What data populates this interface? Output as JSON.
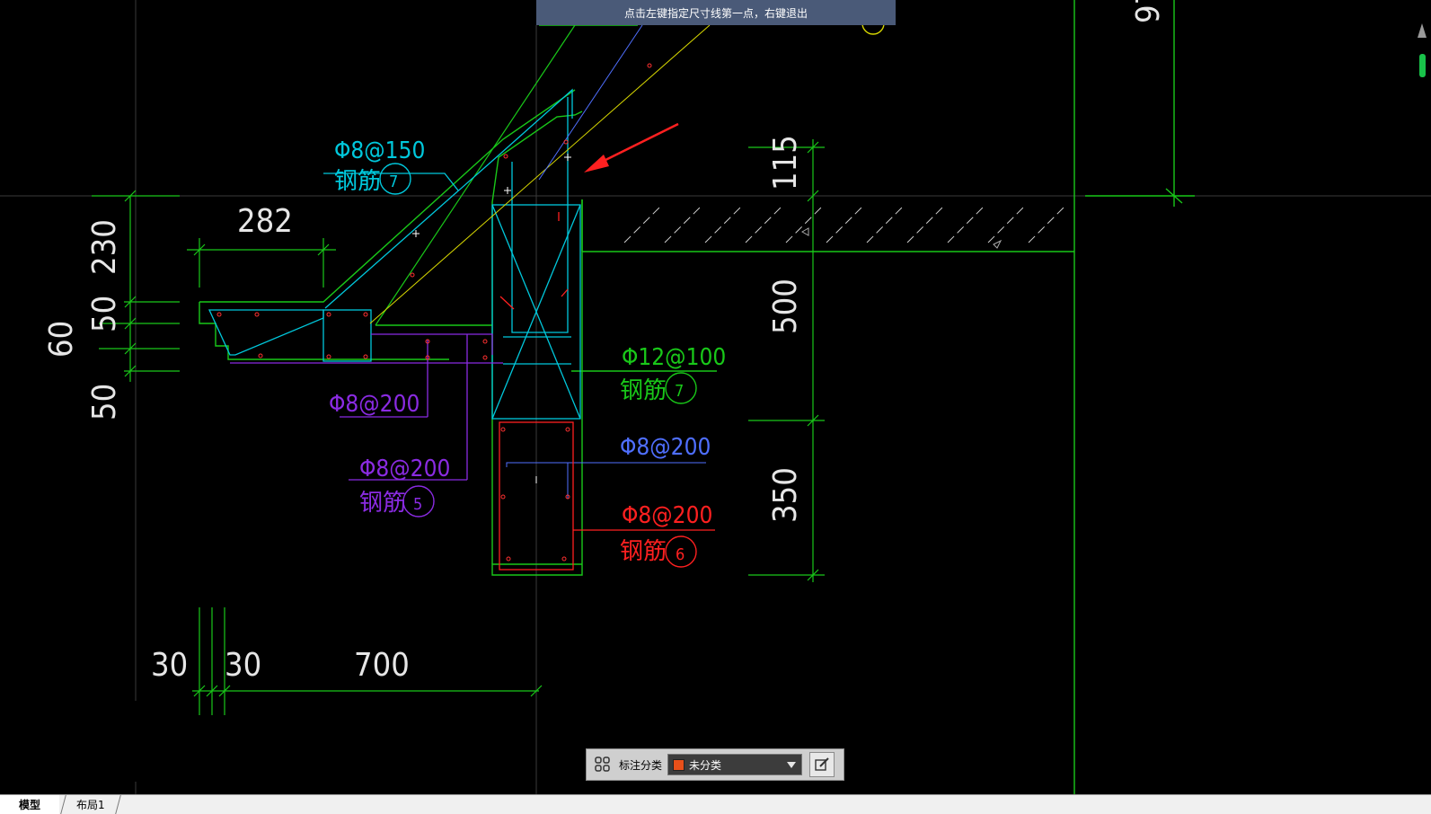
{
  "prompt": {
    "text": "点击左键指定尺寸线第一点，右键退出"
  },
  "dims": {
    "d282": "282",
    "d230": "230",
    "d50a": "50",
    "d60": "60",
    "d50b": "50",
    "d115": "115",
    "d500": "500",
    "d350": "350",
    "d30a": "30",
    "d30b": "30",
    "d700": "700",
    "d_partial": "97"
  },
  "callouts": {
    "c1": {
      "spec": "Φ8@150",
      "label": "钢筋",
      "num": "7"
    },
    "c2": {
      "spec": "Φ8@200"
    },
    "c3": {
      "spec": "Φ8@200",
      "label": "钢筋",
      "num": "5"
    },
    "c4": {
      "spec": "Φ12@100",
      "label": "钢筋",
      "num": "7"
    },
    "c5": {
      "spec": "Φ8@200"
    },
    "c6": {
      "spec": "Φ8@200",
      "label": "钢筋",
      "num": "6"
    }
  },
  "toolbar": {
    "icon": "grid-settings-icon",
    "label": "标注分类",
    "select_value": "未分类",
    "swatch_color": "#e8501a",
    "edit_icon": "edit-icon"
  },
  "tabs": {
    "model": "模型",
    "layout": "布局1"
  },
  "colors": {
    "green": "#19c819",
    "cyan": "#00c8dc",
    "purple": "#8a2be2",
    "red": "#ff2020",
    "blue": "#4f6fff",
    "yellow": "#d8d800",
    "prompt_bg": "#4a5a78"
  }
}
